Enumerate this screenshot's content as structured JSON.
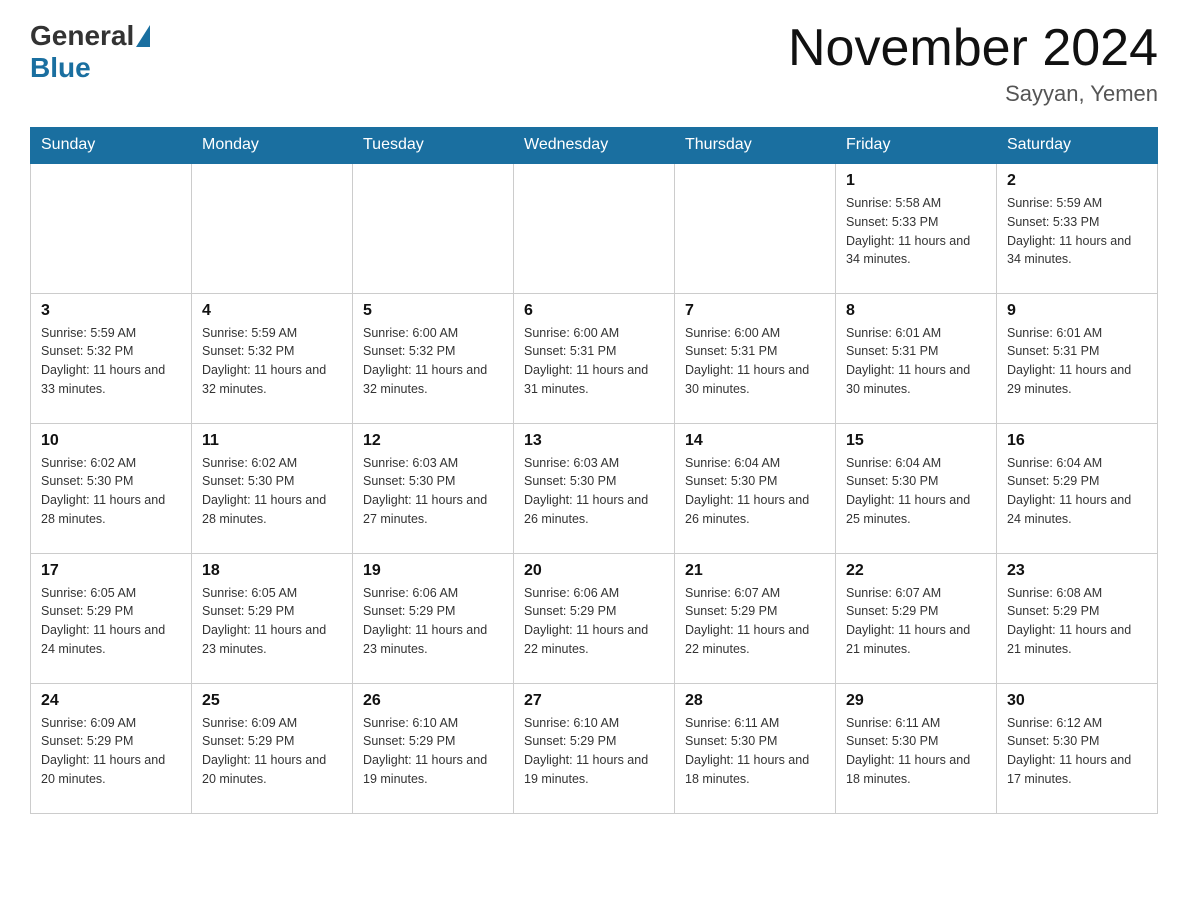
{
  "header": {
    "logo_general": "General",
    "logo_blue": "Blue",
    "title": "November 2024",
    "subtitle": "Sayyan, Yemen"
  },
  "days_of_week": [
    "Sunday",
    "Monday",
    "Tuesday",
    "Wednesday",
    "Thursday",
    "Friday",
    "Saturday"
  ],
  "weeks": [
    [
      {
        "day": "",
        "info": ""
      },
      {
        "day": "",
        "info": ""
      },
      {
        "day": "",
        "info": ""
      },
      {
        "day": "",
        "info": ""
      },
      {
        "day": "",
        "info": ""
      },
      {
        "day": "1",
        "info": "Sunrise: 5:58 AM\nSunset: 5:33 PM\nDaylight: 11 hours and 34 minutes."
      },
      {
        "day": "2",
        "info": "Sunrise: 5:59 AM\nSunset: 5:33 PM\nDaylight: 11 hours and 34 minutes."
      }
    ],
    [
      {
        "day": "3",
        "info": "Sunrise: 5:59 AM\nSunset: 5:32 PM\nDaylight: 11 hours and 33 minutes."
      },
      {
        "day": "4",
        "info": "Sunrise: 5:59 AM\nSunset: 5:32 PM\nDaylight: 11 hours and 32 minutes."
      },
      {
        "day": "5",
        "info": "Sunrise: 6:00 AM\nSunset: 5:32 PM\nDaylight: 11 hours and 32 minutes."
      },
      {
        "day": "6",
        "info": "Sunrise: 6:00 AM\nSunset: 5:31 PM\nDaylight: 11 hours and 31 minutes."
      },
      {
        "day": "7",
        "info": "Sunrise: 6:00 AM\nSunset: 5:31 PM\nDaylight: 11 hours and 30 minutes."
      },
      {
        "day": "8",
        "info": "Sunrise: 6:01 AM\nSunset: 5:31 PM\nDaylight: 11 hours and 30 minutes."
      },
      {
        "day": "9",
        "info": "Sunrise: 6:01 AM\nSunset: 5:31 PM\nDaylight: 11 hours and 29 minutes."
      }
    ],
    [
      {
        "day": "10",
        "info": "Sunrise: 6:02 AM\nSunset: 5:30 PM\nDaylight: 11 hours and 28 minutes."
      },
      {
        "day": "11",
        "info": "Sunrise: 6:02 AM\nSunset: 5:30 PM\nDaylight: 11 hours and 28 minutes."
      },
      {
        "day": "12",
        "info": "Sunrise: 6:03 AM\nSunset: 5:30 PM\nDaylight: 11 hours and 27 minutes."
      },
      {
        "day": "13",
        "info": "Sunrise: 6:03 AM\nSunset: 5:30 PM\nDaylight: 11 hours and 26 minutes."
      },
      {
        "day": "14",
        "info": "Sunrise: 6:04 AM\nSunset: 5:30 PM\nDaylight: 11 hours and 26 minutes."
      },
      {
        "day": "15",
        "info": "Sunrise: 6:04 AM\nSunset: 5:30 PM\nDaylight: 11 hours and 25 minutes."
      },
      {
        "day": "16",
        "info": "Sunrise: 6:04 AM\nSunset: 5:29 PM\nDaylight: 11 hours and 24 minutes."
      }
    ],
    [
      {
        "day": "17",
        "info": "Sunrise: 6:05 AM\nSunset: 5:29 PM\nDaylight: 11 hours and 24 minutes."
      },
      {
        "day": "18",
        "info": "Sunrise: 6:05 AM\nSunset: 5:29 PM\nDaylight: 11 hours and 23 minutes."
      },
      {
        "day": "19",
        "info": "Sunrise: 6:06 AM\nSunset: 5:29 PM\nDaylight: 11 hours and 23 minutes."
      },
      {
        "day": "20",
        "info": "Sunrise: 6:06 AM\nSunset: 5:29 PM\nDaylight: 11 hours and 22 minutes."
      },
      {
        "day": "21",
        "info": "Sunrise: 6:07 AM\nSunset: 5:29 PM\nDaylight: 11 hours and 22 minutes."
      },
      {
        "day": "22",
        "info": "Sunrise: 6:07 AM\nSunset: 5:29 PM\nDaylight: 11 hours and 21 minutes."
      },
      {
        "day": "23",
        "info": "Sunrise: 6:08 AM\nSunset: 5:29 PM\nDaylight: 11 hours and 21 minutes."
      }
    ],
    [
      {
        "day": "24",
        "info": "Sunrise: 6:09 AM\nSunset: 5:29 PM\nDaylight: 11 hours and 20 minutes."
      },
      {
        "day": "25",
        "info": "Sunrise: 6:09 AM\nSunset: 5:29 PM\nDaylight: 11 hours and 20 minutes."
      },
      {
        "day": "26",
        "info": "Sunrise: 6:10 AM\nSunset: 5:29 PM\nDaylight: 11 hours and 19 minutes."
      },
      {
        "day": "27",
        "info": "Sunrise: 6:10 AM\nSunset: 5:29 PM\nDaylight: 11 hours and 19 minutes."
      },
      {
        "day": "28",
        "info": "Sunrise: 6:11 AM\nSunset: 5:30 PM\nDaylight: 11 hours and 18 minutes."
      },
      {
        "day": "29",
        "info": "Sunrise: 6:11 AM\nSunset: 5:30 PM\nDaylight: 11 hours and 18 minutes."
      },
      {
        "day": "30",
        "info": "Sunrise: 6:12 AM\nSunset: 5:30 PM\nDaylight: 11 hours and 17 minutes."
      }
    ]
  ]
}
